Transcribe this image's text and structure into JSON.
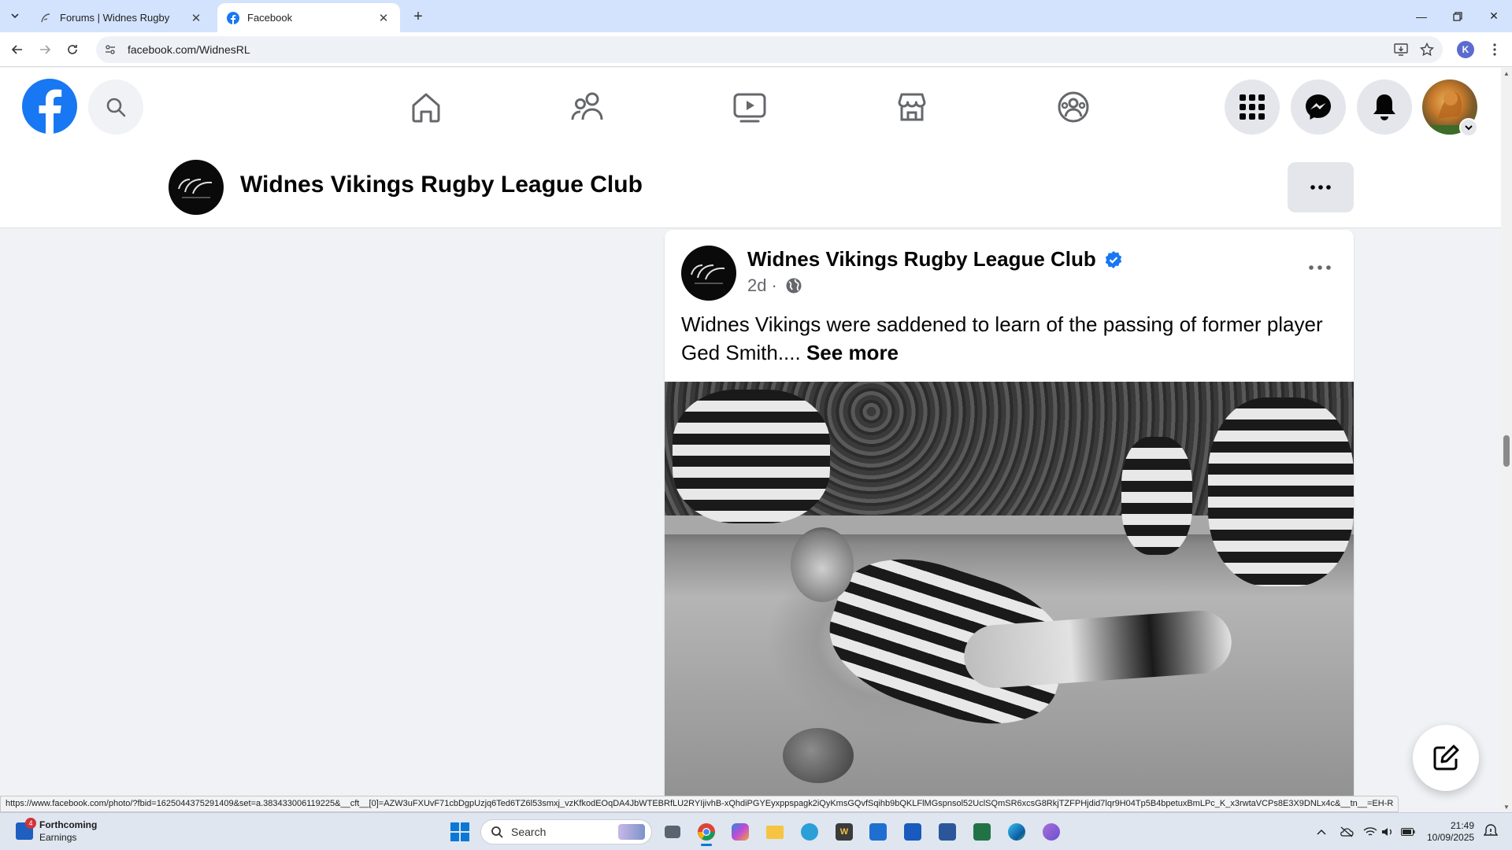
{
  "browser": {
    "tabs": [
      {
        "title": "Forums | Widnes Rugby",
        "active": false
      },
      {
        "title": "Facebook",
        "active": true
      }
    ],
    "url": "facebook.com/WidnesRL",
    "profile_initial": "K"
  },
  "facebook": {
    "nav_icons": [
      "home-icon",
      "friends-icon",
      "watch-icon",
      "marketplace-icon",
      "groups-icon"
    ],
    "right_icons": [
      "menu-grid-icon",
      "messenger-icon",
      "notifications-icon"
    ],
    "brand_color": "#1877f2"
  },
  "page": {
    "name": "Widnes Vikings Rugby League Club"
  },
  "post": {
    "author": "Widnes Vikings Rugby League Club",
    "verified": true,
    "time": "2d",
    "separator": "·",
    "audience": "globe-icon",
    "text": "Widnes Vikings were saddened to learn of the passing of former player Ged Smith.... ",
    "see_more": "See more"
  },
  "status_url": "https://www.facebook.com/photo/?fbid=1625044375291409&set=a.383433006119225&__cft__[0]=AZW3uFXUvF71cbDgpUzjq6Ted6TZ6l53smxj_vzKfkodEOqDA4JbWTEBRfLU2RYIjivhB-xQhdiPGYEyxppspagk2iQyKmsGQvfSqihb9bQKLFlMGspnsol52UclSQmSR6xcsG8RkjTZFPHjdid7lqr9H04Tp5B4bpetuxBmLPc_K_x3rwtaVCPs8E3X9DNLx4c&__tn__=EH-R",
  "taskbar": {
    "weather_badge": "4",
    "weather_line1": "Forthcoming",
    "weather_line2": "Earnings",
    "search_placeholder": "Search",
    "time": "21:49",
    "date": "10/09/2025"
  }
}
